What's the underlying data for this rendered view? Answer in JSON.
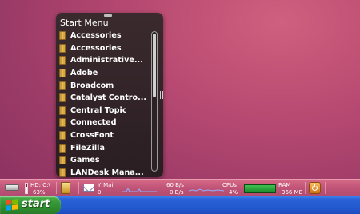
{
  "start_menu": {
    "title": "Start Menu",
    "items": [
      {
        "label": "Accessories"
      },
      {
        "label": "Accessories"
      },
      {
        "label": "Administrative..."
      },
      {
        "label": "Adobe"
      },
      {
        "label": "Broadcom"
      },
      {
        "label": "Catalyst Contro..."
      },
      {
        "label": "Central Topic"
      },
      {
        "label": "Connected"
      },
      {
        "label": "CrossFont"
      },
      {
        "label": "FileZilla"
      },
      {
        "label": "Games"
      },
      {
        "label": "LANDesk Mana..."
      }
    ]
  },
  "system_monitor": {
    "drive": {
      "label": "HD: C:\\",
      "percent_text": "63%",
      "usage": 0.63
    },
    "mail": {
      "label": "Y!Mail",
      "count": "0"
    },
    "network": {
      "upload": "60 B/s",
      "download": "0 B/s"
    },
    "cpu": {
      "label": "CPUs",
      "percent_text": "4%"
    },
    "ram": {
      "label": "RAM",
      "value": "366 MB"
    }
  },
  "taskbar": {
    "start_label": "start"
  },
  "colors": {
    "desktop": "#b84a72",
    "menu_bg": "#2a1e22",
    "taskbar": "#245ad0",
    "start_button": "#3a9a3a",
    "ram_fill": "#1a8a2a"
  }
}
